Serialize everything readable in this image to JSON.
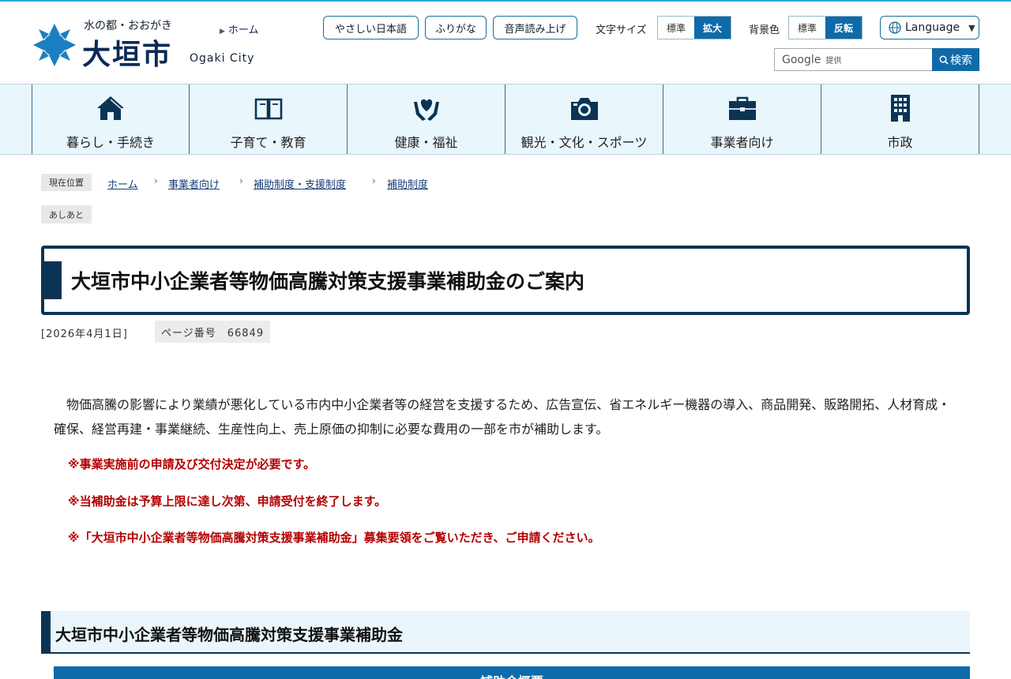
{
  "header": {
    "tagline": "水の都・おおがき",
    "city_name": "大垣市",
    "city_name_en": "Ogaki City",
    "home_link": "ホーム",
    "easy_japanese": "やさしい日本語",
    "furigana": "ふりがな",
    "read_aloud": "音声読み上げ",
    "text_size_label": "文字サイズ",
    "text_size_standard": "標準",
    "text_size_large": "拡大",
    "bg_label": "背景色",
    "bg_standard": "標準",
    "bg_inverted": "反転",
    "language": "Language",
    "search_placeholder_brand": "Google",
    "search_placeholder_suffix": "提供",
    "search_button": "検索"
  },
  "nav": [
    {
      "label": "暮らし・手続き",
      "icon": "home-icon"
    },
    {
      "label": "子育て・教育",
      "icon": "book-icon"
    },
    {
      "label": "健康・福祉",
      "icon": "heart-hands-icon"
    },
    {
      "label": "観光・文化・スポーツ",
      "icon": "camera-icon"
    },
    {
      "label": "事業者向け",
      "icon": "briefcase-icon"
    },
    {
      "label": "市政",
      "icon": "building-icon"
    }
  ],
  "breadcrumb": {
    "tag": "現在位置",
    "items": [
      "ホーム",
      "事業者向け",
      "補助制度・支援制度",
      "補助制度"
    ],
    "sep": "›",
    "ashiato": "あしあと"
  },
  "page": {
    "title": "大垣市中小企業者等物価高騰対策支援事業補助金のご案内",
    "date": "[2026年4月1日]",
    "page_number": "ページ番号　66849",
    "intro": "物価高騰の影響により業績が悪化している市内中小企業者等の経営を支援するため、広告宣伝、省エネルギー機器の導入、商品開発、販路開拓、人材育成・確保、経営再建・事業継続、生産性向上、売上原価の抑制に必要な費用の一部を市が補助します。",
    "notes": [
      "※事業実施前の申請及び交付決定が必要です。",
      "※当補助金は予算上限に達し次第、申請受付を終了します。",
      "※「大垣市中小企業者等物価高騰対策支援事業補助金」募集要領をご覧いただき、ご申請ください。"
    ],
    "section_heading": "大垣市中小企業者等物価高騰対策支援事業補助金",
    "table_header": "補助金概要"
  },
  "colors": {
    "accent": "#0e6aa8",
    "navy": "#0b3454",
    "warning": "#b30000",
    "nav_bg": "#e9f6fb"
  }
}
